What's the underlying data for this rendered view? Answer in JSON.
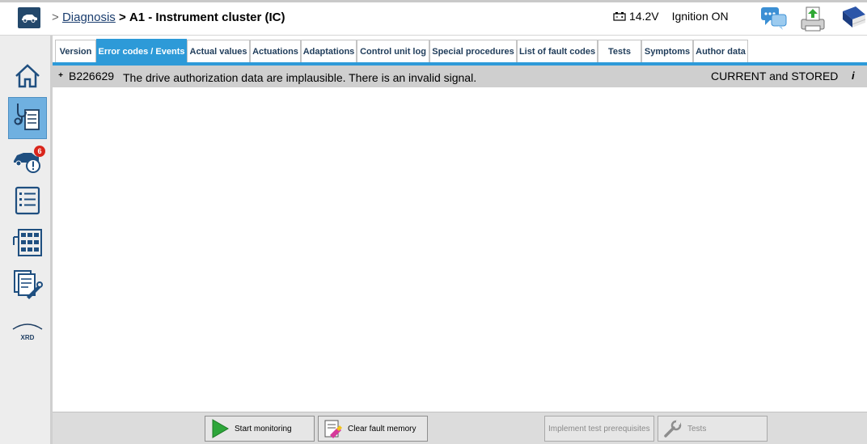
{
  "header": {
    "breadcrumb_sep1": ">",
    "breadcrumb_link": "Diagnosis",
    "breadcrumb_sep2": ">",
    "breadcrumb_current": "A1 - Instrument cluster (IC)",
    "voltage": "14.2V",
    "ignition": "Ignition ON",
    "icons": [
      "vehicle-icon",
      "battery-icon",
      "chat-icon",
      "printer-update-icon",
      "manual-book-icon"
    ]
  },
  "sidebar": {
    "items": [
      {
        "name": "home-icon"
      },
      {
        "name": "diagnosis-icon",
        "active": true
      },
      {
        "name": "vehicle-faults-icon",
        "badge": "6"
      },
      {
        "name": "list-icon"
      },
      {
        "name": "network-icon"
      },
      {
        "name": "documents-tools-icon"
      },
      {
        "name": "xrd-icon",
        "label": "XRD"
      }
    ]
  },
  "tabs": [
    {
      "label": "Version"
    },
    {
      "label": "Error codes / Events",
      "active": true
    },
    {
      "label": "Actual values"
    },
    {
      "label": "Actuations"
    },
    {
      "label": "Adaptations"
    },
    {
      "label": "Control unit log"
    },
    {
      "label": "Special procedures"
    },
    {
      "label": "List of fault codes"
    },
    {
      "label": "Tests"
    },
    {
      "label": "Symptoms"
    },
    {
      "label": "Author data"
    }
  ],
  "faults": [
    {
      "expander": "+",
      "code": "B226629",
      "description": "The drive authorization data are implausible. There is an invalid signal.",
      "status": "CURRENT and STORED",
      "info": "i"
    }
  ],
  "bottom": {
    "start_monitoring": "Start monitoring",
    "clear_fault_memory": "Clear fault memory",
    "implement_prereq": "Implement test prerequisites",
    "tests": "Tests"
  },
  "colors": {
    "accent": "#2d9ad8",
    "header_dark": "#23486b",
    "badge": "#d9261c",
    "row_bg": "#cfcfcf"
  }
}
